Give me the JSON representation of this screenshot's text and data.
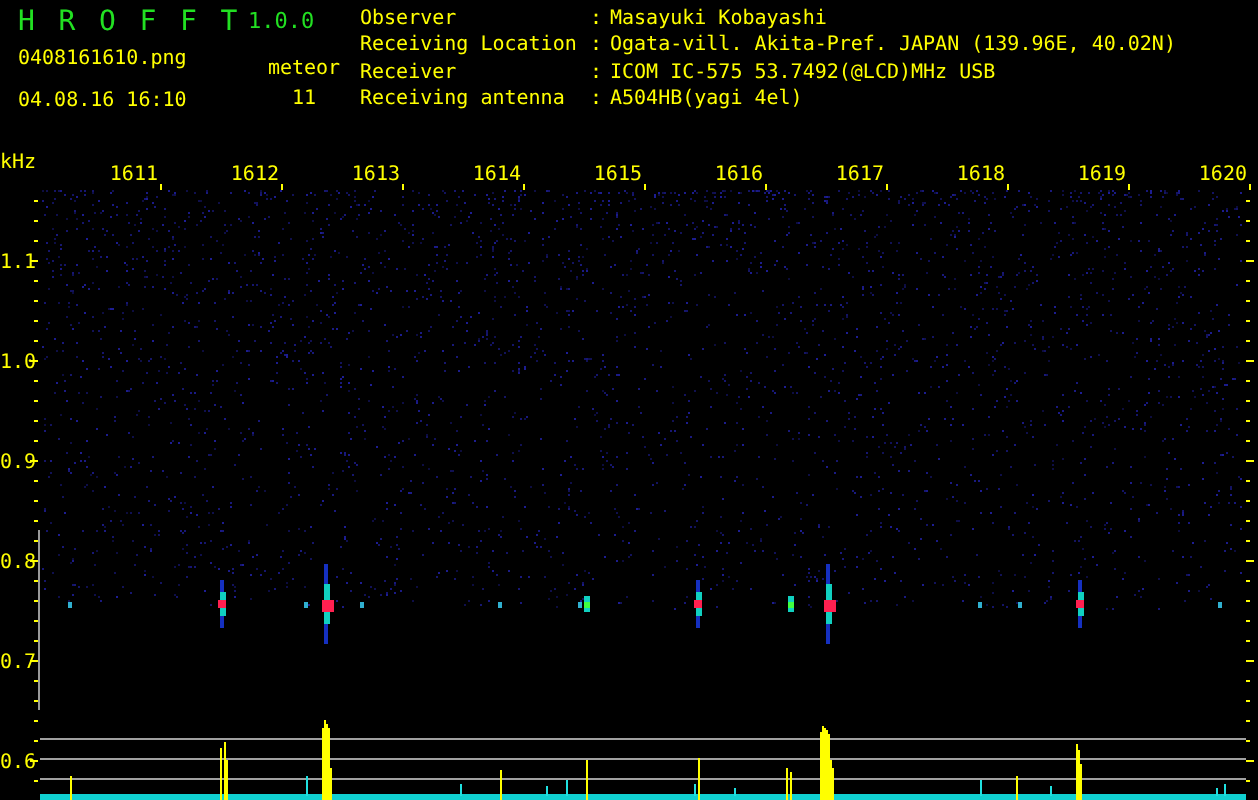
{
  "app": {
    "title": "H R O F F T",
    "version": "1.0.0"
  },
  "file": "0408161610.png",
  "timestamp": "04.08.16 16:10",
  "meteor": {
    "label": "meteor",
    "count": "11"
  },
  "info": [
    {
      "label": "Observer",
      "separator": ":",
      "value": "Masayuki Kobayashi"
    },
    {
      "label": "Receiving Location",
      "separator": ":",
      "value": "Ogata-vill. Akita-Pref. JAPAN (139.96E, 40.02N)"
    },
    {
      "label": "Receiver",
      "separator": ":",
      "value": "ICOM IC-575 53.7492(@LCD)MHz USB"
    },
    {
      "label": "Receiving antenna",
      "separator": ":",
      "value": "A504HB(yagi 4el)"
    }
  ],
  "plot": {
    "y_unit": "kHz",
    "x_ticks": [
      "1611",
      "1612",
      "1613",
      "1614",
      "1615",
      "1616",
      "1617",
      "1618",
      "1619",
      "1620"
    ],
    "y_ticks": [
      "1.1",
      "1.0",
      "0.9",
      "0.8",
      "0.7",
      "0.6"
    ]
  }
}
